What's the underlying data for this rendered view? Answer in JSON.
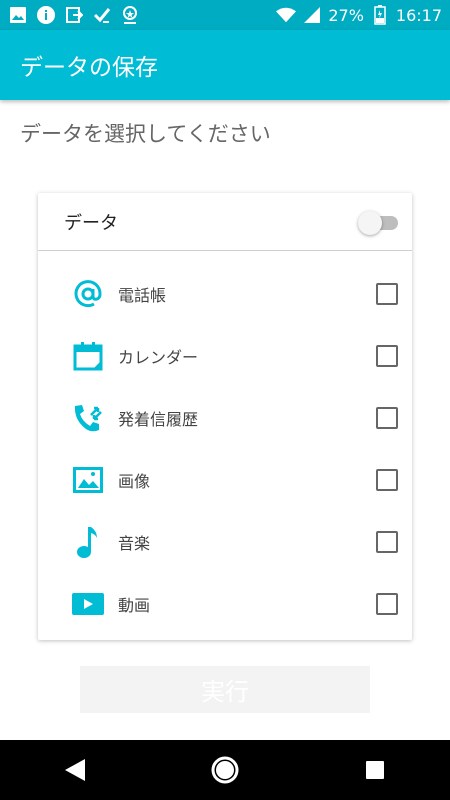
{
  "status_bar": {
    "battery": "27%",
    "time": "16:17",
    "icons_left": [
      "image-icon",
      "info-icon",
      "export-icon",
      "check-icon",
      "location-icon"
    ],
    "icons_right": [
      "wifi-icon",
      "signal-icon",
      "battery-icon"
    ]
  },
  "app_bar": {
    "title": "データの保存"
  },
  "prompt": "データを選択してください",
  "card": {
    "header_label": "データ",
    "toggle_on": false,
    "items": [
      {
        "label": "電話帳",
        "icon": "at-icon"
      },
      {
        "label": "カレンダー",
        "icon": "calendar-icon"
      },
      {
        "label": "発着信履歴",
        "icon": "call-log-icon"
      },
      {
        "label": "画像",
        "icon": "image-icon"
      },
      {
        "label": "音楽",
        "icon": "music-note-icon"
      },
      {
        "label": "動画",
        "icon": "video-icon"
      }
    ]
  },
  "exec_button": {
    "label": "実行"
  },
  "colors": {
    "primary": "#00bcd4",
    "status_bar": "#00acc1",
    "nav_bar": "#000000"
  }
}
